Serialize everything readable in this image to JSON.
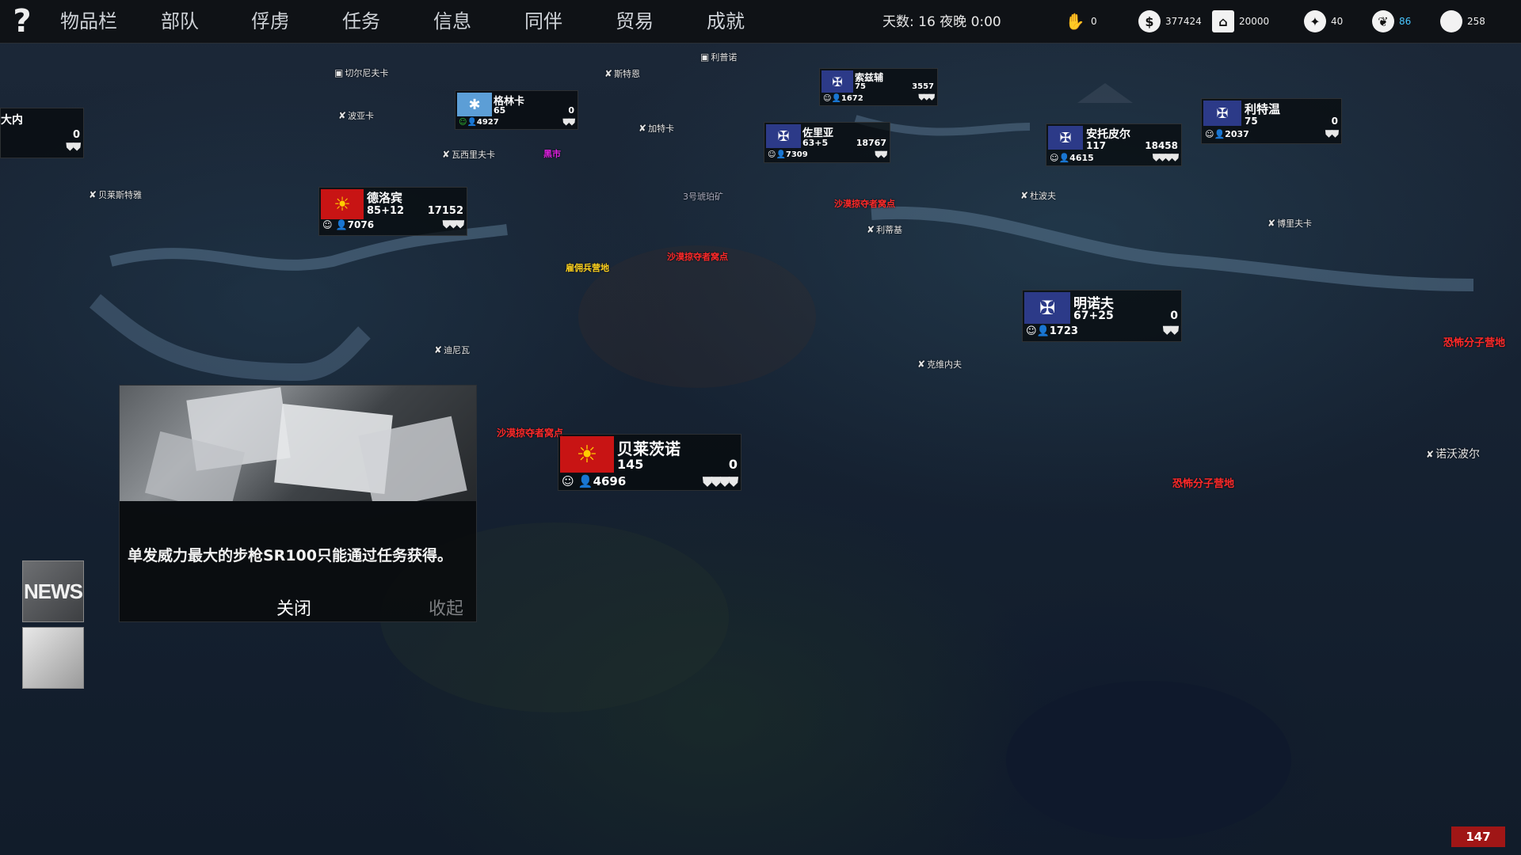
{
  "topbar": {
    "help": "?",
    "menu": [
      "物品栏",
      "部队",
      "俘虏",
      "任务",
      "信息",
      "同伴",
      "贸易",
      "成就"
    ],
    "day_label": "天数: 16 夜晚 0:00",
    "resources": [
      {
        "icon": "hand-money-icon",
        "value": "0",
        "color": "#eeeeee"
      },
      {
        "icon": "coin-icon",
        "value": "377424",
        "color": "#eeeeee"
      },
      {
        "icon": "bank-icon",
        "value": "20000",
        "color": "#eeeeee"
      },
      {
        "icon": "medal-icon",
        "value": "40",
        "color": "#eeeeee"
      },
      {
        "icon": "wreath-icon",
        "value": "86",
        "color": "#49c6ff"
      },
      {
        "icon": "apple-icon",
        "value": "258",
        "color": "#eeeeee"
      }
    ]
  },
  "places": [
    {
      "text": "切尔尼夫卡",
      "type": "town"
    },
    {
      "text": "利普诺",
      "type": "town"
    },
    {
      "text": "瓦西里夫卡",
      "type": "village"
    },
    {
      "text": "波亚卡",
      "type": "village"
    },
    {
      "text": "贝莱斯特雅",
      "type": "village"
    },
    {
      "text": "迪尼瓦",
      "type": "village"
    },
    {
      "text": "加特卡",
      "type": "village"
    },
    {
      "text": "斯特恩",
      "type": "village"
    },
    {
      "text": "杜波夫",
      "type": "village"
    },
    {
      "text": "博里夫卡",
      "type": "village"
    },
    {
      "text": "利蒂基",
      "type": "village"
    },
    {
      "text": "克维内夫",
      "type": "village"
    },
    {
      "text": "诺沃波尔",
      "type": "village"
    },
    {
      "text": "3号琥珀矿",
      "type": "mine"
    },
    {
      "text": "雇佣兵营地",
      "type": "yellow"
    },
    {
      "text": "沙漠掠夺者窝点",
      "type": "red"
    },
    {
      "text": "沙漠掠夺者窝点",
      "type": "red"
    },
    {
      "text": "沙漠掠夺者窝点",
      "type": "red"
    },
    {
      "text": "恐怖分子营地",
      "type": "red"
    },
    {
      "text": "恐怖分子营地",
      "type": "red"
    },
    {
      "text": "黑市",
      "type": "magenta"
    }
  ],
  "armies": [
    {
      "name": "贝莱茨诺",
      "level": "145",
      "troops": "4696",
      "power": "0",
      "shields": 4,
      "flag": "sun"
    },
    {
      "name": "德洛宾",
      "level": "85+12",
      "troops": "7076",
      "power": "17152",
      "shields": 3,
      "flag": "sun"
    },
    {
      "name": "格林卡",
      "level": "65",
      "troops": "4927",
      "power": "0",
      "shields": 2,
      "flag": "sky"
    },
    {
      "name": "佐里亚",
      "level": "63+5",
      "troops": "7309",
      "power": "18767",
      "shields": 2,
      "flag": "eagle"
    },
    {
      "name": "索兹辅",
      "level": "75",
      "troops": "1672",
      "power": "3557",
      "shields": 3,
      "flag": "eagle"
    },
    {
      "name": "安托皮尔",
      "level": "117",
      "troops": "4615",
      "power": "18458",
      "shields": 4,
      "flag": "eagle"
    },
    {
      "name": "利特温",
      "level": "75",
      "troops": "2037",
      "power": "0",
      "shields": 2,
      "flag": "eagle"
    },
    {
      "name": "明诺夫",
      "level": "67+25",
      "troops": "1723",
      "power": "0",
      "shields": 2,
      "flag": "eagle"
    },
    {
      "name": "大内",
      "level": "",
      "troops": "",
      "power": "0",
      "shields": 2,
      "flag": "none"
    }
  ],
  "news": {
    "text": "单发威力最大的步枪SR100只能通过任务获得。",
    "close": "关闭",
    "collapse": "收起",
    "thumb_label": "NEWS"
  },
  "counter": "147"
}
